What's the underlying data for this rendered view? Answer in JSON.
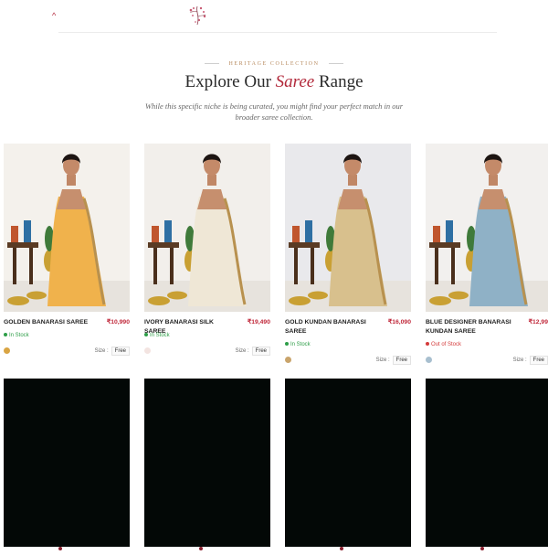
{
  "header": {
    "eyebrow": "HERITAGE COLLECTION",
    "title_part1": "Explore Our ",
    "title_highlight": "Saree",
    "title_part2": " Range",
    "subtitle": "While this specific niche is being curated, you might find your perfect match in our broader saree collection."
  },
  "colors": {
    "accent": "#b2283a",
    "in_stock": "#2e9e48",
    "out_of_stock": "#d43b3b",
    "gold": "#b7895d"
  },
  "products": [
    {
      "name": "GOLDEN BANARASI SAREE",
      "price": "₹10,990",
      "stock": "In Stock",
      "stock_status": "in",
      "swatch": "#d9a443",
      "size_label": "Size :",
      "size": "Free",
      "saree_color": "#f0b24c",
      "wall": "#f4f1ec"
    },
    {
      "name": "IVORY BANARASI SILK SAREE",
      "price": "₹19,490",
      "stock": "In Stock",
      "stock_status": "in",
      "swatch": "#f3e4e1",
      "size_label": "Size :",
      "size": "Free",
      "saree_color": "#efe7d6",
      "wall": "#f2efeb"
    },
    {
      "name": "GOLD KUNDAN BANARASI SAREE",
      "price": "₹16,090",
      "stock": "In Stock",
      "stock_status": "in",
      "swatch": "#c9a46b",
      "size_label": "Size :",
      "size": "Free",
      "saree_color": "#d8c08d",
      "wall": "#e9e9ec"
    },
    {
      "name": "BLUE DESIGNER BANARASI KUNDAN SAREE",
      "price": "₹12,99",
      "stock": "Out of Stock",
      "stock_status": "out",
      "swatch": "#a8bfcf",
      "size_label": "Size :",
      "size": "Free",
      "saree_color": "#8fb1c6",
      "wall": "#f2f0ee"
    }
  ]
}
